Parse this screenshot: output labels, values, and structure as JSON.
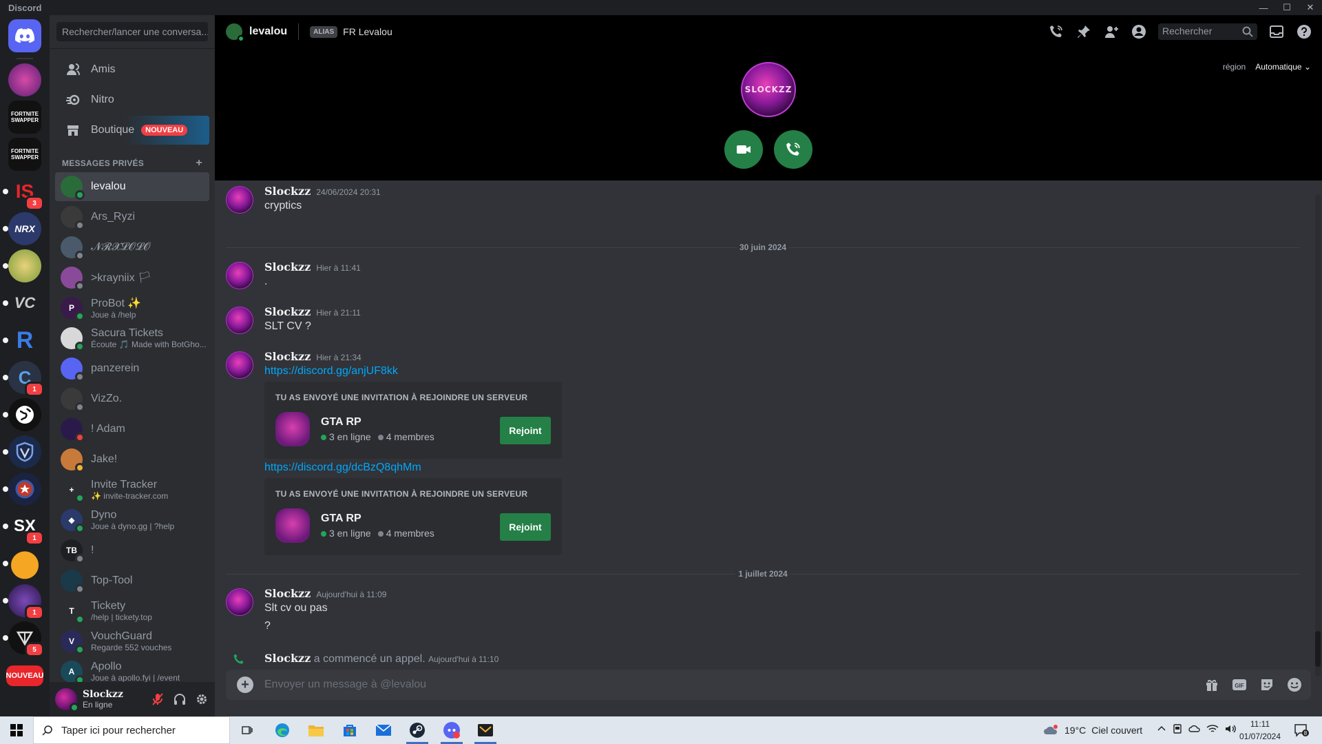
{
  "window": {
    "title": "Discord",
    "controls": [
      "—",
      "☐",
      "✕"
    ]
  },
  "colors": {
    "online": "#23a55a",
    "blurple": "#5865f2",
    "green": "#248046",
    "red": "#f23f43",
    "link": "#00a8fc"
  },
  "rail": {
    "home_icon": "discord-logo-icon",
    "new_label": "NOUVEAU",
    "servers": [
      {
        "label": "",
        "badge": ""
      },
      {
        "label": "FORTNITE SWAPPER",
        "badge": ""
      },
      {
        "label": "FORTNITE SWAPPER",
        "badge": ""
      },
      {
        "label": "IS",
        "badge": "3"
      },
      {
        "label": "NRX",
        "badge": ""
      },
      {
        "label": "",
        "badge": ""
      },
      {
        "label": "VC",
        "badge": ""
      },
      {
        "label": "R",
        "badge": ""
      },
      {
        "label": "C",
        "badge": "1"
      },
      {
        "label": "",
        "badge": ""
      },
      {
        "label": "",
        "badge": ""
      },
      {
        "label": "",
        "badge": ""
      },
      {
        "label": "SX",
        "badge": "1"
      },
      {
        "label": "",
        "badge": ""
      },
      {
        "label": "",
        "badge": "1"
      },
      {
        "label": "",
        "badge": "5"
      }
    ]
  },
  "dm_sidebar": {
    "search_placeholder": "Rechercher/lancer une conversa...",
    "nav": [
      {
        "label": "Amis",
        "icon": "friends-icon"
      },
      {
        "label": "Nitro",
        "icon": "nitro-icon"
      },
      {
        "label": "Boutique",
        "icon": "shop-icon",
        "badge": "NOUVEAU"
      }
    ],
    "section_title": "MESSAGES PRIVÉS",
    "add_label": "+",
    "dms": [
      {
        "name": "levalou",
        "sub": "",
        "status": "online",
        "active": true,
        "avatar_text": ""
      },
      {
        "name": "Ars_Ryzi",
        "sub": "",
        "status": "offline",
        "avatar_text": ""
      },
      {
        "name": "𝓝𝓡𝓧𝓛𝓞𝓛𝓞",
        "sub": "",
        "status": "offline",
        "avatar_text": ""
      },
      {
        "name": ">krayniix 🏳",
        "sub": "",
        "status": "offline",
        "avatar_text": ""
      },
      {
        "name": "ProBot ✨",
        "sub": "Joue à /help",
        "status": "online",
        "avatar_text": "P"
      },
      {
        "name": "Sacura Tickets",
        "sub": "Écoute 🎵 Made with BotGho...",
        "status": "online",
        "avatar_text": ""
      },
      {
        "name": "panzerein",
        "sub": "",
        "status": "offline",
        "avatar_text": ""
      },
      {
        "name": "VizZo.",
        "sub": "",
        "status": "offline",
        "avatar_text": ""
      },
      {
        "name": "! Adam",
        "sub": "",
        "status": "dnd",
        "avatar_text": ""
      },
      {
        "name": "Jake!",
        "sub": "",
        "status": "idle",
        "avatar_text": ""
      },
      {
        "name": "Invite Tracker",
        "sub": "✨ invite-tracker.com",
        "status": "online",
        "avatar_text": "+"
      },
      {
        "name": "Dyno",
        "sub": "Joue à dyno.gg | ?help",
        "status": "online",
        "avatar_text": "◆"
      },
      {
        "name": "!",
        "sub": "",
        "status": "offline",
        "avatar_text": "TB"
      },
      {
        "name": "Top-Tool",
        "sub": "",
        "status": "offline",
        "avatar_text": ""
      },
      {
        "name": "Tickety",
        "sub": "/help | tickety.top",
        "status": "online",
        "avatar_text": "T"
      },
      {
        "name": "VouchGuard",
        "sub": "Regarde 552 vouches",
        "status": "online",
        "avatar_text": "V"
      },
      {
        "name": "Apollo",
        "sub": "Joue à apollo.fyi | /event",
        "status": "online",
        "avatar_text": "A"
      }
    ]
  },
  "user_panel": {
    "name": "Slockzz",
    "status": "En ligne"
  },
  "header": {
    "name": "levalou",
    "alias_tag": "ALIAS",
    "alias_value": "FR Levalou",
    "search_placeholder": "Rechercher",
    "region_label": "région",
    "region_value": "Automatique"
  },
  "call": {
    "avatar_text": "SLOCKZZ"
  },
  "messages": [
    {
      "author": "Slockzz",
      "time": "24/06/2024 20:31",
      "lines": [
        "cryptics"
      ]
    },
    {
      "date": "30 juin 2024"
    },
    {
      "author": "Slockzz",
      "time": "Hier à 11:41",
      "lines": [
        "."
      ]
    },
    {
      "author": "Slockzz",
      "time": "Hier à 21:11",
      "lines": [
        "SLT CV ?"
      ]
    },
    {
      "author": "Slockzz",
      "time": "Hier à 21:34",
      "links": [
        "https://discord.gg/anjUF8kk",
        "https://discord.gg/dcBzQ8qhMm"
      ]
    },
    {
      "date": "1 juillet 2024"
    },
    {
      "author": "Slockzz",
      "time": "Aujourd'hui à 11:09",
      "lines": [
        "Slt cv ou pas",
        "?"
      ]
    }
  ],
  "invite": {
    "title": "TU AS ENVOYÉ UNE INVITATION À REJOINDRE UN SERVEUR",
    "server_name": "GTA RP",
    "online": "3 en ligne",
    "members": "4 membres",
    "button": "Rejoint"
  },
  "system_call": {
    "author": "Slockzz",
    "text": " a commencé un appel.",
    "time": "Aujourd'hui à 11:10"
  },
  "composer": {
    "placeholder": "Envoyer un message à @levalou",
    "gif_label": "GIF"
  },
  "taskbar": {
    "search_placeholder": "Taper ici pour rechercher",
    "temperature": "19°C",
    "weather": "Ciel couvert",
    "time": "11:11",
    "date": "01/07/2024",
    "notif_count": "8"
  }
}
